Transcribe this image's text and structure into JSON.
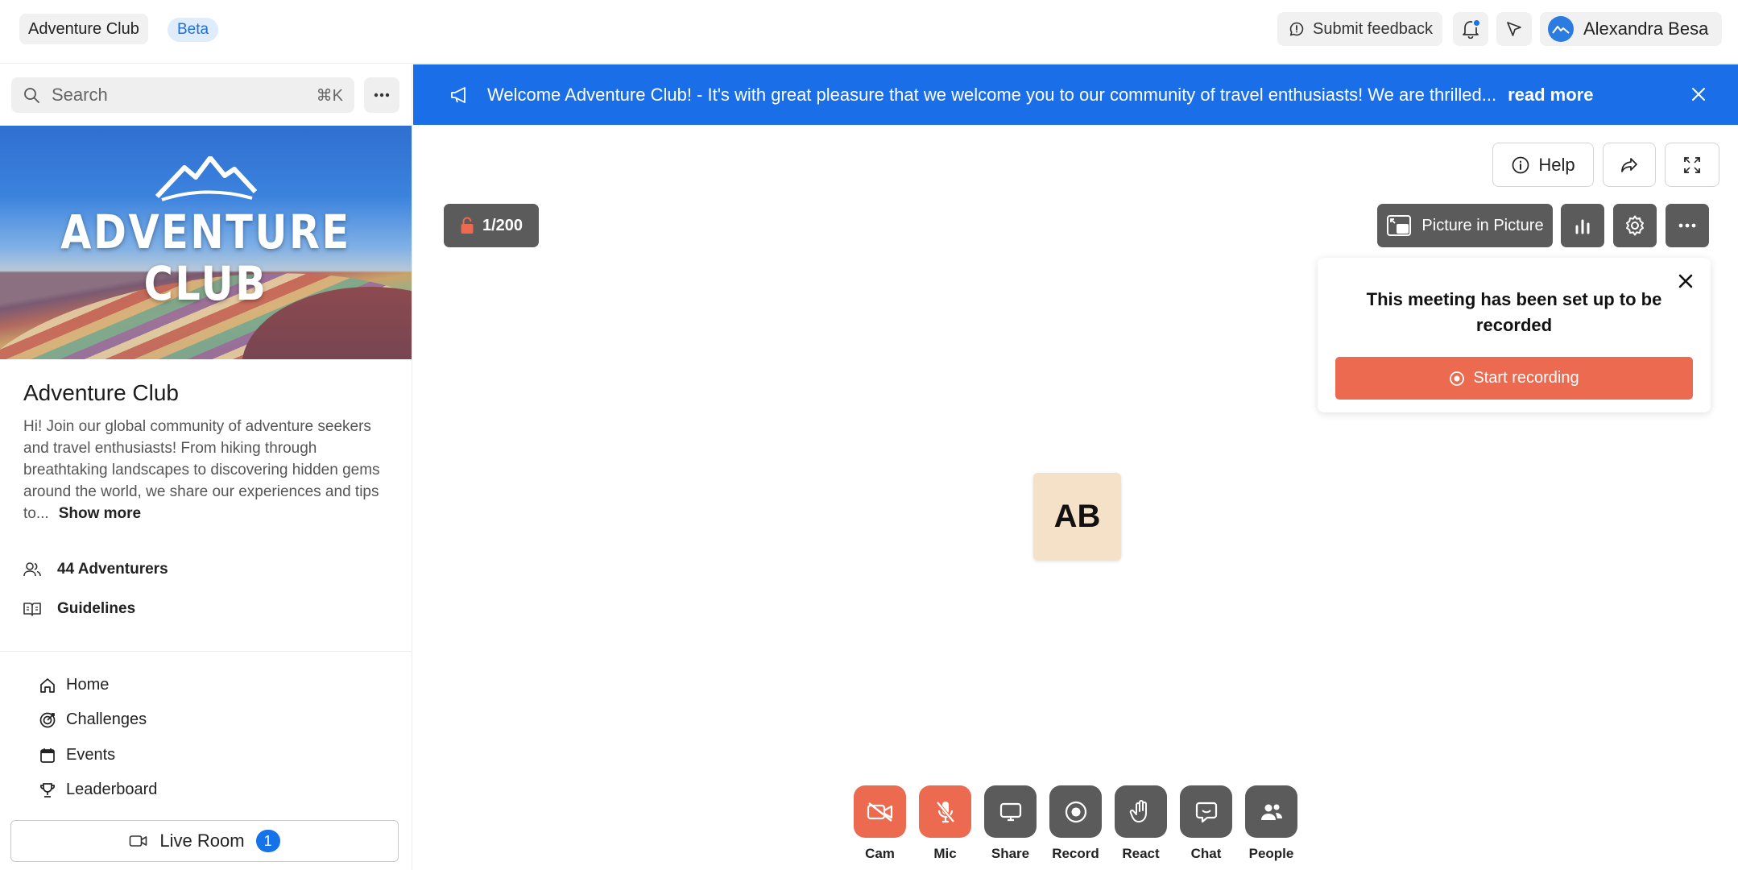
{
  "topbar": {
    "community_name": "Adventure Club",
    "beta_badge": "Beta",
    "feedback_label": "Submit feedback",
    "user_name": "Alexandra Besa"
  },
  "sidebar": {
    "search": {
      "placeholder": "Search",
      "shortcut": "⌘K"
    },
    "banner_title_line1": "ADVENTURE",
    "banner_title_line2": "CLUB",
    "club_name": "Adventure Club",
    "description": "Hi! Join our global community of adventure seekers and travel enthusiasts! From hiking through breathtaking landscapes to discovering hidden gems around the world, we share our experiences and tips to...",
    "show_more": "Show more",
    "members": "44 Adventurers",
    "guidelines": "Guidelines",
    "nav": [
      {
        "label": "Home",
        "icon": "home-icon"
      },
      {
        "label": "Challenges",
        "icon": "target-icon"
      },
      {
        "label": "Events",
        "icon": "calendar-icon"
      },
      {
        "label": "Leaderboard",
        "icon": "trophy-icon"
      }
    ],
    "live_room": {
      "label": "Live Room",
      "count": "1"
    }
  },
  "announcement": {
    "text": "Welcome Adventure Club! - It's with great pleasure that we welcome you to our community of travel enthusiasts! We are thrilled...",
    "read_more": "read more"
  },
  "meeting": {
    "help_label": "Help",
    "participants": "1/200",
    "pip_label": "Picture in Picture",
    "recording_popup": {
      "title": "This meeting has been set up to be recorded",
      "button": "Start recording"
    },
    "avatar_initials": "AB",
    "controls": [
      {
        "label": "Cam",
        "state": "off"
      },
      {
        "label": "Mic",
        "state": "off"
      },
      {
        "label": "Share"
      },
      {
        "label": "Record"
      },
      {
        "label": "React"
      },
      {
        "label": "Chat"
      },
      {
        "label": "People"
      }
    ]
  },
  "colors": {
    "accent_blue": "#1a6fe8",
    "record_red": "#ec6a4f",
    "control_gray": "#5b5b5b",
    "avatar_bg": "#f5e1c8"
  }
}
